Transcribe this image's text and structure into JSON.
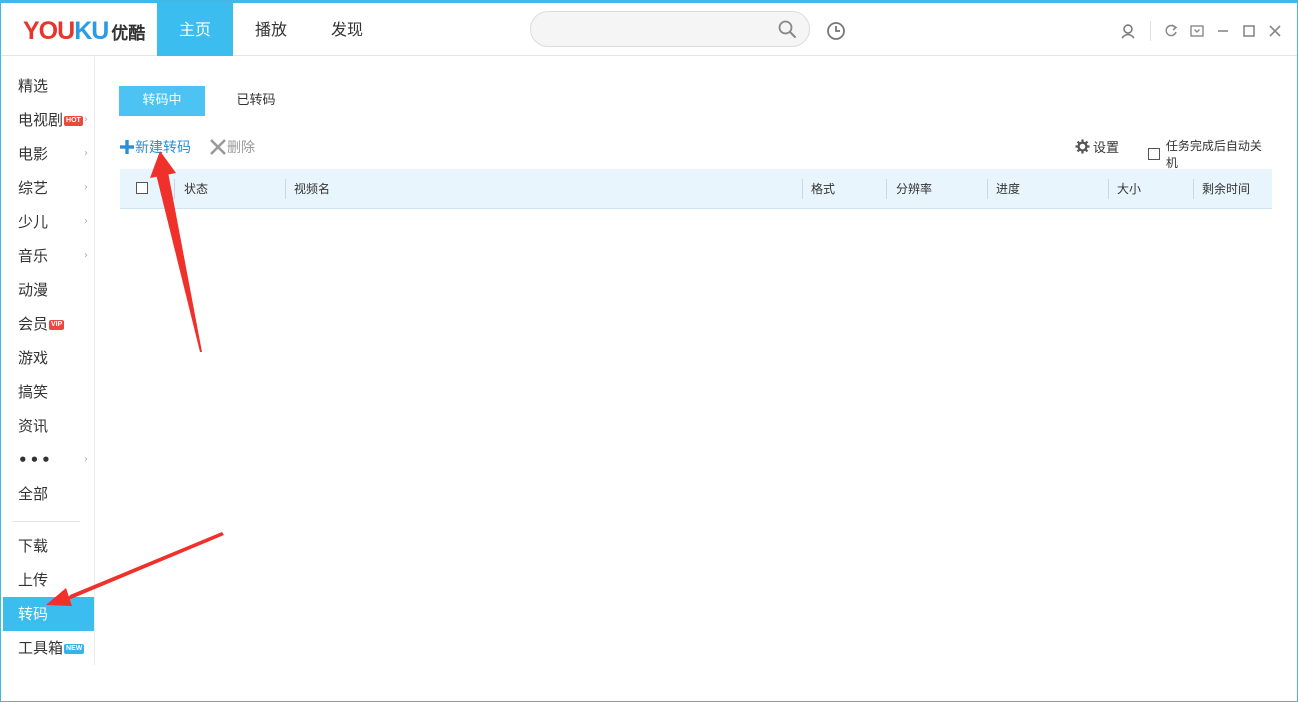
{
  "app": {
    "logo_en_you": "YOU",
    "logo_en_ku": "KU",
    "logo_cn": "优酷"
  },
  "nav": {
    "tabs": [
      {
        "label": "主页",
        "active": true
      },
      {
        "label": "播放",
        "active": false
      },
      {
        "label": "发现",
        "active": false
      }
    ]
  },
  "search": {
    "placeholder": ""
  },
  "sidebar": {
    "items": [
      {
        "label": "精选"
      },
      {
        "label": "电视剧",
        "badge": "HOT",
        "chevron": "›"
      },
      {
        "label": "电影",
        "chevron": "›"
      },
      {
        "label": "综艺",
        "chevron": "›"
      },
      {
        "label": "少儿",
        "chevron": "›"
      },
      {
        "label": "音乐",
        "chevron": "›"
      },
      {
        "label": "动漫"
      },
      {
        "label": "会员",
        "badge": "VIP"
      },
      {
        "label": "游戏"
      },
      {
        "label": "搞笑"
      },
      {
        "label": "资讯"
      },
      {
        "label": "•••",
        "chevron": "›"
      },
      {
        "label": "全部"
      }
    ],
    "bottom_items": [
      {
        "label": "下载"
      },
      {
        "label": "上传"
      },
      {
        "label": "转码",
        "active": true
      },
      {
        "label": "工具箱",
        "badge": "NEW"
      }
    ]
  },
  "main": {
    "sub_tabs": [
      {
        "label": "转码中",
        "active": true
      },
      {
        "label": "已转码",
        "active": false
      }
    ],
    "toolbar": {
      "new_label": "新建转码",
      "delete_label": "删除",
      "settings_label": "设置",
      "auto_shutdown_label": "任务完成后自动关机"
    },
    "table": {
      "columns": [
        "状态",
        "视频名",
        "格式",
        "分辨率",
        "进度",
        "大小",
        "剩余时间"
      ]
    }
  },
  "colors": {
    "accent": "#3bbdf0",
    "brand_red": "#e8352c",
    "annotation_arrow": "#f0302a"
  }
}
